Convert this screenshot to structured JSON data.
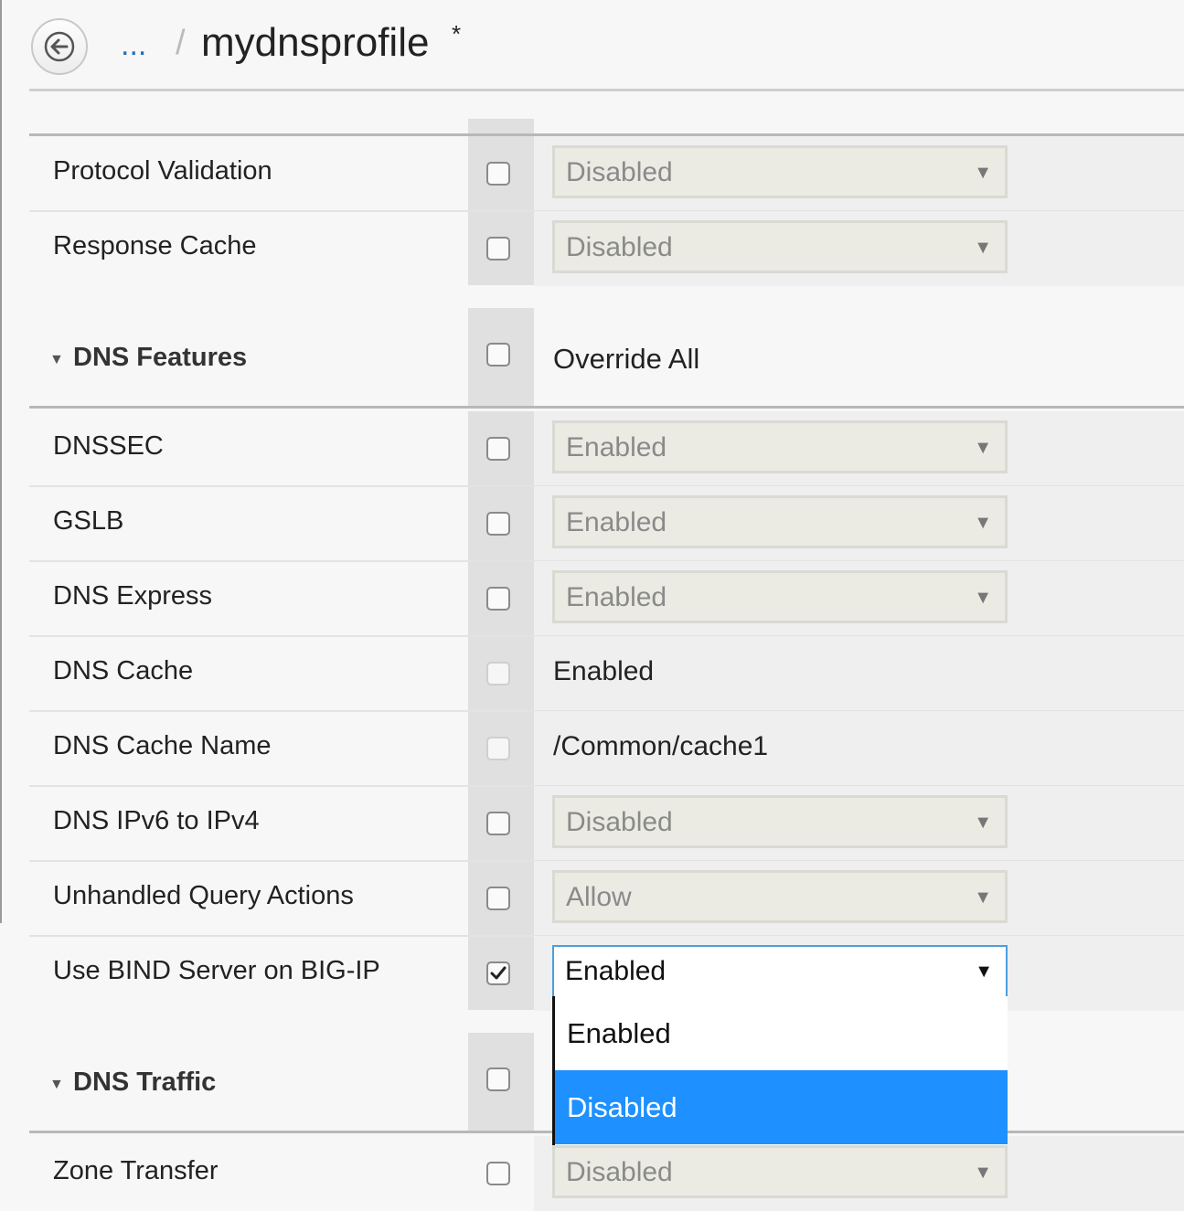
{
  "header": {
    "breadcrumb_ellipsis": "...",
    "breadcrumb_separator": "/",
    "title": "mydnsprofile",
    "unsaved_marker": "*",
    "back_icon": "arrow-left-icon"
  },
  "rows_top": [
    {
      "label": "Protocol Validation",
      "value": "Disabled",
      "checked": false
    },
    {
      "label": "Response Cache",
      "value": "Disabled",
      "checked": false
    }
  ],
  "dns_features": {
    "title": "DNS Features",
    "override_label": "Override All",
    "rows": [
      {
        "label": "DNSSEC",
        "value": "Enabled"
      },
      {
        "label": "GSLB",
        "value": "Enabled"
      },
      {
        "label": "DNS Express",
        "value": "Enabled"
      },
      {
        "label": "DNS Cache",
        "value": "Enabled"
      },
      {
        "label": "DNS Cache Name",
        "value": "/Common/cache1"
      },
      {
        "label": "DNS IPv6 to IPv4",
        "value": "Disabled"
      },
      {
        "label": "Unhandled Query Actions",
        "value": "Allow"
      },
      {
        "label": "Use BIND Server on BIG-IP",
        "value": "Enabled",
        "checked": true
      }
    ]
  },
  "dropdown": {
    "options": [
      "Enabled",
      "Disabled"
    ],
    "highlighted": "Disabled"
  },
  "dns_traffic": {
    "title": "DNS Traffic",
    "rows": [
      {
        "label": "Zone Transfer",
        "value": "Disabled"
      }
    ]
  },
  "colors": {
    "highlight": "#1e90ff",
    "link": "#1f6fbf",
    "active_border": "#4a9fe0"
  }
}
